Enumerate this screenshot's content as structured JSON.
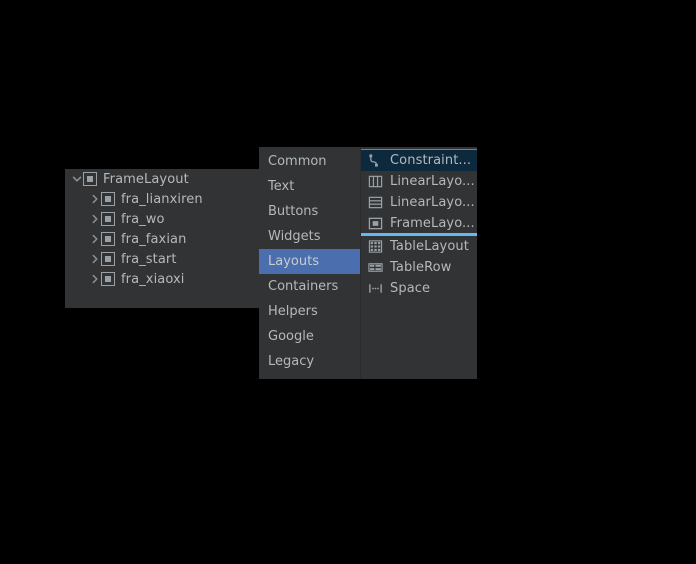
{
  "component_tree": {
    "panel_name": "component-tree",
    "rows": [
      {
        "label": "FrameLayout",
        "depth": 0,
        "expanded": true,
        "twisty": "chevron-down-icon",
        "icon": "framelayout-icon"
      },
      {
        "label": "fra_lianxiren",
        "depth": 1,
        "expanded": false,
        "twisty": "chevron-right-icon",
        "icon": "framelayout-icon"
      },
      {
        "label": "fra_wo",
        "depth": 1,
        "expanded": false,
        "twisty": "chevron-right-icon",
        "icon": "framelayout-icon"
      },
      {
        "label": "fra_faxian",
        "depth": 1,
        "expanded": false,
        "twisty": "chevron-right-icon",
        "icon": "framelayout-icon"
      },
      {
        "label": "fra_start",
        "depth": 1,
        "expanded": false,
        "twisty": "chevron-right-icon",
        "icon": "framelayout-icon"
      },
      {
        "label": "fra_xiaoxi",
        "depth": 1,
        "expanded": false,
        "twisty": "chevron-right-icon",
        "icon": "framelayout-icon"
      }
    ]
  },
  "palette": {
    "categories": [
      {
        "label": "Common",
        "selected": false
      },
      {
        "label": "Text",
        "selected": false
      },
      {
        "label": "Buttons",
        "selected": false
      },
      {
        "label": "Widgets",
        "selected": false
      },
      {
        "label": "Layouts",
        "selected": true
      },
      {
        "label": "Containers",
        "selected": false
      },
      {
        "label": "Helpers",
        "selected": false
      },
      {
        "label": "Google",
        "selected": false
      },
      {
        "label": "Legacy",
        "selected": false
      }
    ],
    "items": [
      {
        "label": "Constraint...",
        "icon": "constraintlayout-icon",
        "selected": true,
        "drop_line_after": false
      },
      {
        "label": "LinearLayo...",
        "icon": "linearlayout-horizontal-icon",
        "selected": false,
        "drop_line_after": false
      },
      {
        "label": "LinearLayo...",
        "icon": "linearlayout-vertical-icon",
        "selected": false,
        "drop_line_after": false
      },
      {
        "label": "FrameLayo...",
        "icon": "framelayout-icon",
        "selected": false,
        "drop_line_after": true
      },
      {
        "label": "TableLayout",
        "icon": "tablelayout-icon",
        "selected": false,
        "drop_line_after": false
      },
      {
        "label": "TableRow",
        "icon": "tablerow-icon",
        "selected": false,
        "drop_line_after": false
      },
      {
        "label": "Space",
        "icon": "space-icon",
        "selected": false,
        "drop_line_after": false
      }
    ]
  },
  "colors": {
    "background": "#000000",
    "panel": "#313335",
    "panel_alt": "#3c3f41",
    "text": "#b5b9ba",
    "selection_blue": "#4b6eaf",
    "selected_item_bg": "#0d293e",
    "selected_item_border": "#4a88c7",
    "drop_indicator": "#62b8f2",
    "icon_gray": "#9aa1a6"
  }
}
